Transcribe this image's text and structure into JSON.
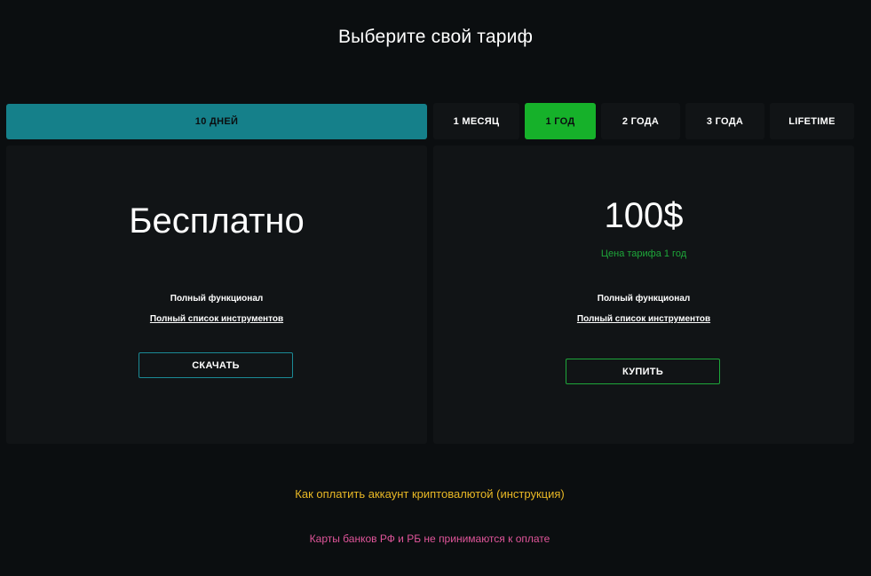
{
  "page": {
    "title": "Выберите свой тариф"
  },
  "tabs": {
    "free": {
      "label": "10 ДНЕЙ"
    },
    "periods": [
      {
        "label": "1 МЕСЯЦ",
        "active": false
      },
      {
        "label": "1 ГОД",
        "active": true
      },
      {
        "label": "2 ГОДА",
        "active": false
      },
      {
        "label": "3 ГОДА",
        "active": false
      },
      {
        "label": "LIFETIME",
        "active": false
      }
    ]
  },
  "free_plan": {
    "price": "Бесплатно",
    "feature": "Полный функционал",
    "tools_link": "Полный список инструментов",
    "button_label": "СКАЧАТЬ"
  },
  "paid_plan": {
    "price": "100$",
    "price_note": "Цена тарифа 1 год",
    "feature": "Полный функционал",
    "tools_link": "Полный список инструментов",
    "button_label": "КУПИТЬ"
  },
  "footer": {
    "crypto_link": "Как оплатить аккаунт криптовалютой (инструкция)",
    "bank_note": "Карты банков РФ и РБ не принимаются к оплате"
  },
  "colors": {
    "background": "#0b0e10",
    "card": "#111416",
    "teal": "#15808a",
    "green": "#16b12a",
    "yellow": "#e9b825",
    "pink": "#e0559a"
  }
}
